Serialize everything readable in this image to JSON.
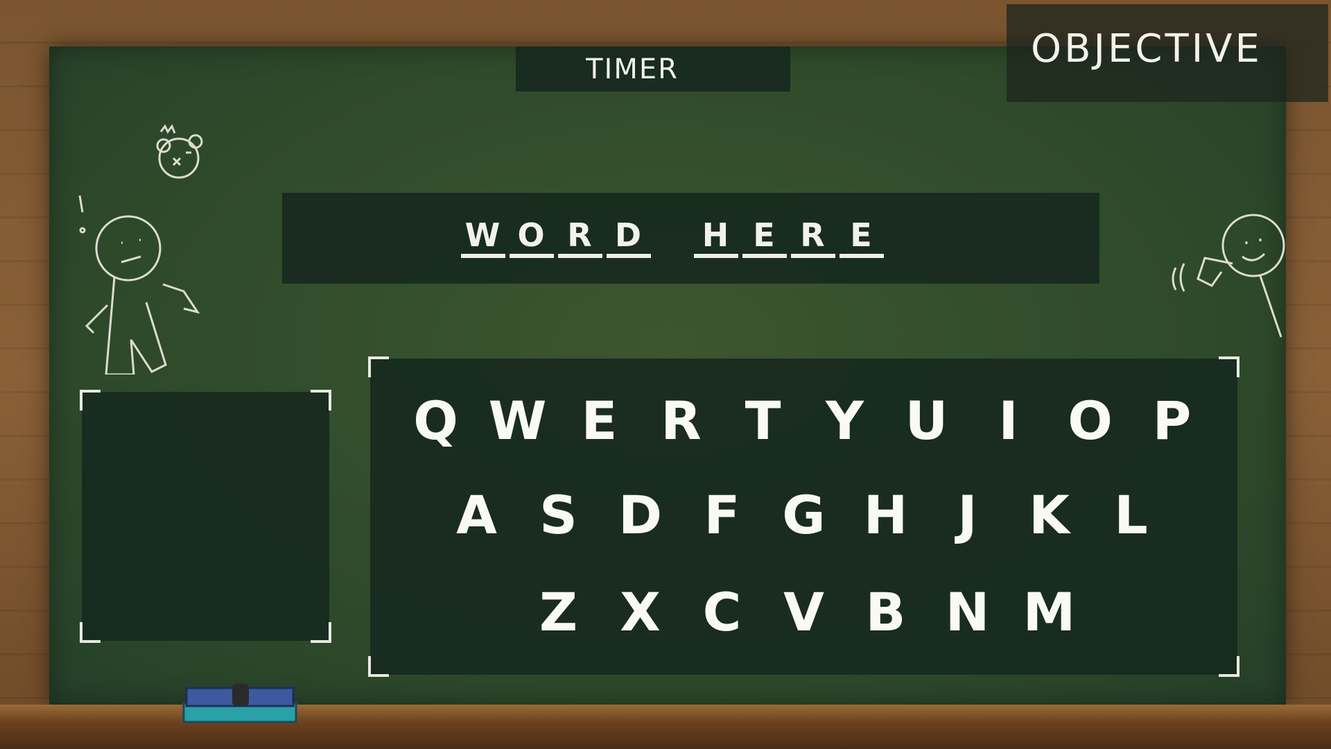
{
  "hud": {
    "timer_label": "TIMER",
    "objective_label": "OBJECTIVE"
  },
  "word": {
    "letters": [
      "W",
      "O",
      "R",
      "D",
      " ",
      "H",
      "E",
      "R",
      "E"
    ]
  },
  "keyboard": {
    "rows": [
      [
        "Q",
        "W",
        "E",
        "R",
        "T",
        "Y",
        "U",
        "I",
        "O",
        "P"
      ],
      [
        "A",
        "S",
        "D",
        "F",
        "G",
        "H",
        "J",
        "K",
        "L"
      ],
      [
        "Z",
        "X",
        "C",
        "V",
        "B",
        "N",
        "M"
      ]
    ]
  },
  "colors": {
    "board": "#2f4a2a",
    "panel": "#16281e",
    "chalk": "#f2f2ea",
    "wood": "#7a5530",
    "eraser_top": "#3d5aa0",
    "eraser_base": "#2aa0a8"
  },
  "decorations": [
    "bear-doodle",
    "surprised-stick-figure",
    "waving-stick-figure",
    "eraser"
  ]
}
